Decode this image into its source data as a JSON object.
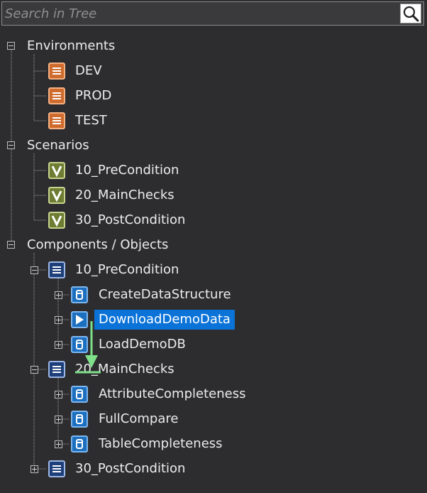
{
  "search": {
    "placeholder": "Search in Tree"
  },
  "tree": {
    "environments": {
      "label": "Environments",
      "items": [
        "DEV",
        "PROD",
        "TEST"
      ]
    },
    "scenarios": {
      "label": "Scenarios",
      "items": [
        "10_PreCondition",
        "20_MainChecks",
        "30_PostCondition"
      ]
    },
    "components": {
      "label": "Components / Objects",
      "groups": [
        {
          "label": "10_PreCondition",
          "children": [
            "CreateDataStructure",
            "DownloadDemoData",
            "LoadDemoDB"
          ]
        },
        {
          "label": "20_MainChecks",
          "children": [
            "AttributeCompleteness",
            "FullCompare",
            "TableCompleteness"
          ]
        },
        {
          "label": "30_PostCondition",
          "children": []
        }
      ]
    },
    "selected_item": "DownloadDemoData"
  },
  "colors": {
    "background": "#2d2d30",
    "selection": "#0b73d8",
    "environment_icon": "#cf6c2d",
    "scenario_icon": "#6e7d33",
    "object_icon": "#1c6fbf",
    "drag_arrow": "#7fe08a"
  },
  "icons": {
    "search": "magnifier-icon",
    "environment": "list-doc-icon",
    "scenario": "check-v-icon",
    "group": "list-doc-icon",
    "object": "database-icon",
    "object_running": "play-icon"
  }
}
